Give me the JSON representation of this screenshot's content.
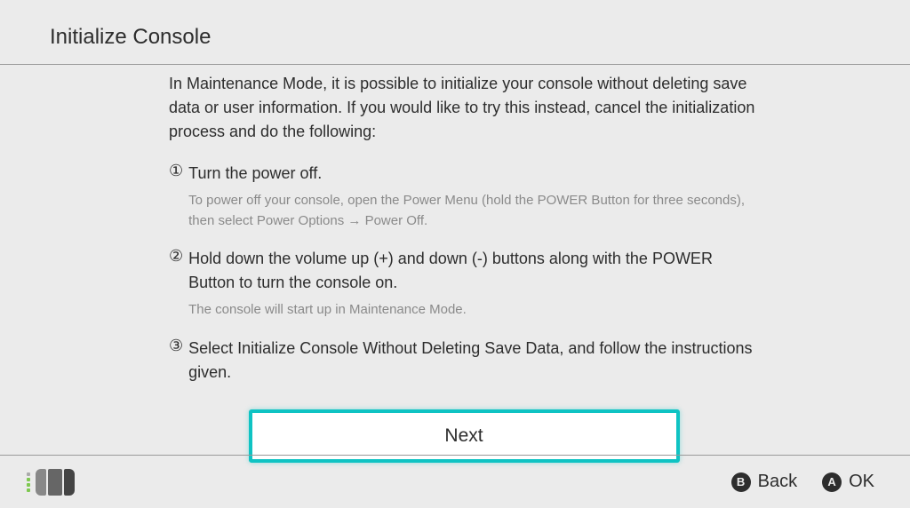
{
  "header": {
    "title": "Initialize Console"
  },
  "content": {
    "intro": "In Maintenance Mode, it is possible to initialize your console without deleting save data or user information. If you would like to try this instead, cancel the initialization process and do the following:",
    "steps": [
      {
        "num": "①",
        "text": "Turn the power off.",
        "note": "To power off your console, open the Power Menu (hold the POWER Button for three seconds), then select Power Options → Power Off."
      },
      {
        "num": "②",
        "text": "Hold down the volume up (+) and down (-) buttons along with the POWER Button to turn the console on.",
        "note": "The console will start up in Maintenance Mode."
      },
      {
        "num": "③",
        "text": "Select Initialize Console Without Deleting Save Data, and follow the instructions given.",
        "note": ""
      }
    ],
    "next_label": "Next"
  },
  "footer": {
    "back": {
      "button": "B",
      "label": "Back"
    },
    "ok": {
      "button": "A",
      "label": "OK"
    }
  }
}
